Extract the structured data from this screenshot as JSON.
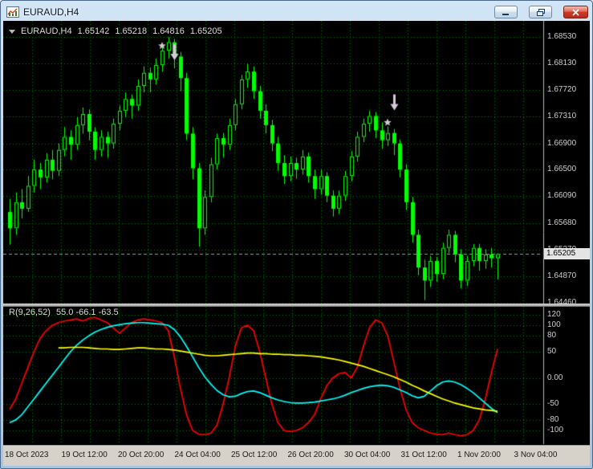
{
  "window": {
    "title": "EURAUD,H4"
  },
  "chart_header": {
    "symbol": "EURAUD,H4",
    "open": "1.65142",
    "high": "1.65218",
    "low": "1.64816",
    "close": "1.65205"
  },
  "price_tag": "1.65205",
  "indicator_header": {
    "name": "R(9,26,52)",
    "values": "55.0 -66.1 -63.5"
  },
  "axes": {
    "price_labels": [
      "1.68530",
      "1.68130",
      "1.67720",
      "1.67310",
      "1.66900",
      "1.66500",
      "1.66090",
      "1.65680",
      "1.65270",
      "1.64870",
      "1.64460"
    ],
    "oscillator_labels": [
      "120",
      "100",
      "80",
      "50",
      "0.00",
      "-50",
      "-80",
      "-100"
    ],
    "time_labels": [
      "18 Oct 2023",
      "19 Oct 12:00",
      "20 Oct 20:00",
      "24 Oct 04:00",
      "25 Oct 12:00",
      "26 Oct 20:00",
      "30 Oct 04:00",
      "31 Oct 12:00",
      "1 Nov 20:00",
      "3 Nov 04:00"
    ]
  },
  "colors": {
    "background": "#000000",
    "grid": "#007d00",
    "candle": "#00ff00",
    "bull_fill": "#000000",
    "bear_fill": "#00ff00",
    "bid_line": "#9aa0a0",
    "axis_text": "#cdcdcd",
    "price_tag_bg": "#e4e4e4",
    "marker_arrow": "#d8c8dc",
    "marker_star": "#cccccc",
    "osc_red": "#ff0000",
    "osc_cyan": "#00ffff",
    "osc_yellow": "#ffff00",
    "divider": "#b2b2b2",
    "time_axis_bg": "#d6d2ca",
    "titlebar_bg": "#bcd6ee"
  },
  "chart_data": {
    "type": "candlestick",
    "symbol": "EURAUD",
    "timeframe": "H4",
    "price_range": [
      1.6446,
      1.6853
    ],
    "current_bar": {
      "open": 1.65142,
      "high": 1.65218,
      "low": 1.64816,
      "close": 1.65205
    },
    "candles": [
      [
        1.6585,
        1.6605,
        1.6535,
        1.656
      ],
      [
        1.656,
        1.6615,
        1.655,
        1.66
      ],
      [
        1.66,
        1.662,
        1.6575,
        1.659
      ],
      [
        1.659,
        1.664,
        1.6585,
        1.6625
      ],
      [
        1.6625,
        1.6665,
        1.6615,
        1.665
      ],
      [
        1.665,
        1.666,
        1.662,
        1.6638
      ],
      [
        1.6638,
        1.6675,
        1.663,
        1.6665
      ],
      [
        1.6665,
        1.668,
        1.6635,
        1.6648
      ],
      [
        1.6648,
        1.669,
        1.664,
        1.668
      ],
      [
        1.668,
        1.6715,
        1.667,
        1.67
      ],
      [
        1.67,
        1.671,
        1.6665,
        1.6688
      ],
      [
        1.6688,
        1.673,
        1.668,
        1.6718
      ],
      [
        1.6718,
        1.6745,
        1.6705,
        1.6735
      ],
      [
        1.6735,
        1.6742,
        1.6695,
        1.6708
      ],
      [
        1.6708,
        1.6715,
        1.6665,
        1.668
      ],
      [
        1.668,
        1.671,
        1.667,
        1.67
      ],
      [
        1.67,
        1.6708,
        1.6668,
        1.669
      ],
      [
        1.669,
        1.6728,
        1.6682,
        1.672
      ],
      [
        1.672,
        1.6748,
        1.671,
        1.674
      ],
      [
        1.674,
        1.6768,
        1.673,
        1.6758
      ],
      [
        1.6758,
        1.6765,
        1.6728,
        1.6748
      ],
      [
        1.6748,
        1.6788,
        1.674,
        1.6778
      ],
      [
        1.6778,
        1.6808,
        1.6768,
        1.6798
      ],
      [
        1.6798,
        1.6806,
        1.6768,
        1.6788
      ],
      [
        1.6788,
        1.682,
        1.678,
        1.681
      ],
      [
        1.681,
        1.6843,
        1.68,
        1.6832
      ],
      [
        1.6832,
        1.6853,
        1.682,
        1.6845
      ],
      [
        1.6845,
        1.685,
        1.6805,
        1.6823
      ],
      [
        1.6823,
        1.683,
        1.677,
        1.679
      ],
      [
        1.679,
        1.6798,
        1.6695,
        1.6705
      ],
      [
        1.6705,
        1.6715,
        1.6635,
        1.6652
      ],
      [
        1.6652,
        1.666,
        1.6532,
        1.656
      ],
      [
        1.656,
        1.6618,
        1.655,
        1.6608
      ],
      [
        1.6608,
        1.6668,
        1.66,
        1.6658
      ],
      [
        1.6658,
        1.6705,
        1.665,
        1.6698
      ],
      [
        1.6698,
        1.6706,
        1.6668,
        1.6688
      ],
      [
        1.6688,
        1.6728,
        1.668,
        1.6718
      ],
      [
        1.6718,
        1.6758,
        1.671,
        1.675
      ],
      [
        1.675,
        1.6795,
        1.6742,
        1.6788
      ],
      [
        1.6788,
        1.6812,
        1.6775,
        1.68
      ],
      [
        1.68,
        1.6808,
        1.6758,
        1.677
      ],
      [
        1.677,
        1.6778,
        1.6728,
        1.674
      ],
      [
        1.674,
        1.675,
        1.6705,
        1.6718
      ],
      [
        1.6718,
        1.6726,
        1.6678,
        1.669
      ],
      [
        1.669,
        1.67,
        1.6648,
        1.666
      ],
      [
        1.666,
        1.6672,
        1.6628,
        1.664
      ],
      [
        1.664,
        1.667,
        1.6632,
        1.666
      ],
      [
        1.666,
        1.6668,
        1.6636,
        1.665
      ],
      [
        1.665,
        1.668,
        1.6642,
        1.667
      ],
      [
        1.667,
        1.6676,
        1.663,
        1.664
      ],
      [
        1.664,
        1.665,
        1.6605,
        1.662
      ],
      [
        1.662,
        1.665,
        1.6612,
        1.664
      ],
      [
        1.664,
        1.6646,
        1.66,
        1.661
      ],
      [
        1.661,
        1.6618,
        1.6578,
        1.659
      ],
      [
        1.659,
        1.6618,
        1.6582,
        1.661
      ],
      [
        1.661,
        1.6648,
        1.6602,
        1.664
      ],
      [
        1.664,
        1.6678,
        1.6632,
        1.667
      ],
      [
        1.667,
        1.6708,
        1.6662,
        1.67
      ],
      [
        1.67,
        1.6728,
        1.6692,
        1.672
      ],
      [
        1.672,
        1.674,
        1.6708,
        1.6732
      ],
      [
        1.6732,
        1.6738,
        1.6698,
        1.671
      ],
      [
        1.671,
        1.6722,
        1.6682,
        1.6695
      ],
      [
        1.6695,
        1.6716,
        1.6686,
        1.6706
      ],
      [
        1.6706,
        1.6712,
        1.6672,
        1.669
      ],
      [
        1.669,
        1.6696,
        1.6638,
        1.665
      ],
      [
        1.665,
        1.6658,
        1.6588,
        1.66
      ],
      [
        1.66,
        1.6608,
        1.6538,
        1.655
      ],
      [
        1.655,
        1.6558,
        1.6488,
        1.65
      ],
      [
        1.65,
        1.6512,
        1.645,
        1.648
      ],
      [
        1.648,
        1.6518,
        1.647,
        1.651
      ],
      [
        1.651,
        1.6516,
        1.6478,
        1.649
      ],
      [
        1.649,
        1.6538,
        1.6482,
        1.653
      ],
      [
        1.653,
        1.6558,
        1.6522,
        1.655
      ],
      [
        1.655,
        1.6556,
        1.6508,
        1.652
      ],
      [
        1.652,
        1.6528,
        1.6468,
        1.648
      ],
      [
        1.648,
        1.6518,
        1.6472,
        1.651
      ],
      [
        1.651,
        1.6536,
        1.6502,
        1.653
      ],
      [
        1.653,
        1.6536,
        1.6495,
        1.651
      ],
      [
        1.651,
        1.6528,
        1.6498,
        1.652
      ],
      [
        1.652,
        1.653,
        1.65,
        1.65142
      ],
      [
        1.65142,
        1.65218,
        1.64816,
        1.65205
      ]
    ],
    "markers": [
      {
        "shape": "arrow-down",
        "index": 27,
        "price": 1.6842
      },
      {
        "shape": "star",
        "index": 25,
        "price": 1.68395
      },
      {
        "shape": "arrow-down",
        "index": 63,
        "price": 1.6765
      },
      {
        "shape": "star",
        "index": 62,
        "price": 1.6722
      }
    ],
    "oscillator": {
      "type": "line",
      "label": "R(9,26,52)",
      "current_values": [
        55.0,
        -66.1,
        -63.5
      ],
      "axis_ticks": [
        120,
        100,
        80,
        50,
        0,
        -50,
        -80,
        -100
      ],
      "series": [
        {
          "name": "line1",
          "color": "#ff0000",
          "values": [
            -60,
            -40,
            -10,
            20,
            50,
            75,
            90,
            100,
            105,
            108,
            110,
            112,
            108,
            113,
            115,
            110,
            105,
            95,
            85,
            95,
            105,
            110,
            112,
            110,
            108,
            105,
            90,
            40,
            -20,
            -70,
            -100,
            -107,
            -108,
            -105,
            -90,
            -50,
            0,
            60,
            95,
            100,
            90,
            50,
            0,
            -50,
            -85,
            -100,
            -102,
            -100,
            -95,
            -85,
            -70,
            -40,
            -15,
            0,
            8,
            10,
            0,
            20,
            60,
            95,
            110,
            105,
            80,
            30,
            -20,
            -60,
            -85,
            -95,
            -100,
            -105,
            -107,
            -108,
            -105,
            -108,
            -110,
            -108,
            -100,
            -80,
            -40,
            10,
            55
          ]
        },
        {
          "name": "line2",
          "color": "#00ffff",
          "values": [
            -85,
            -80,
            -70,
            -55,
            -40,
            -25,
            -10,
            5,
            20,
            35,
            50,
            62,
            72,
            80,
            87,
            92,
            96,
            99,
            101,
            103,
            104,
            105,
            105,
            104,
            103,
            102,
            100,
            92,
            78,
            60,
            40,
            20,
            2,
            -12,
            -24,
            -32,
            -36,
            -35,
            -30,
            -26,
            -25,
            -28,
            -33,
            -38,
            -42,
            -45,
            -47,
            -48,
            -48,
            -47,
            -46,
            -44,
            -42,
            -40,
            -37,
            -33,
            -28,
            -24,
            -20,
            -17,
            -15,
            -14,
            -15,
            -18,
            -23,
            -28,
            -34,
            -38,
            -35,
            -25,
            -15,
            -8,
            -6,
            -8,
            -13,
            -20,
            -28,
            -38,
            -48,
            -58,
            -66
          ]
        },
        {
          "name": "line3",
          "color": "#ffff00",
          "values": [
            null,
            null,
            null,
            null,
            null,
            null,
            null,
            null,
            57,
            57,
            58,
            58,
            58,
            57,
            56,
            55,
            55,
            54,
            54,
            55,
            56,
            57,
            57,
            56,
            55,
            55,
            54,
            53,
            51,
            49,
            47,
            45,
            43,
            42,
            42,
            43,
            44,
            45,
            46,
            47,
            47,
            46,
            46,
            45,
            45,
            44,
            44,
            43,
            43,
            42,
            41,
            40,
            38,
            36,
            34,
            31,
            28,
            25,
            22,
            18,
            14,
            10,
            6,
            2,
            -3,
            -8,
            -14,
            -19,
            -25,
            -30,
            -35,
            -40,
            -44,
            -48,
            -51,
            -54,
            -57,
            -59,
            -61,
            -62,
            -63.5
          ]
        }
      ]
    }
  }
}
